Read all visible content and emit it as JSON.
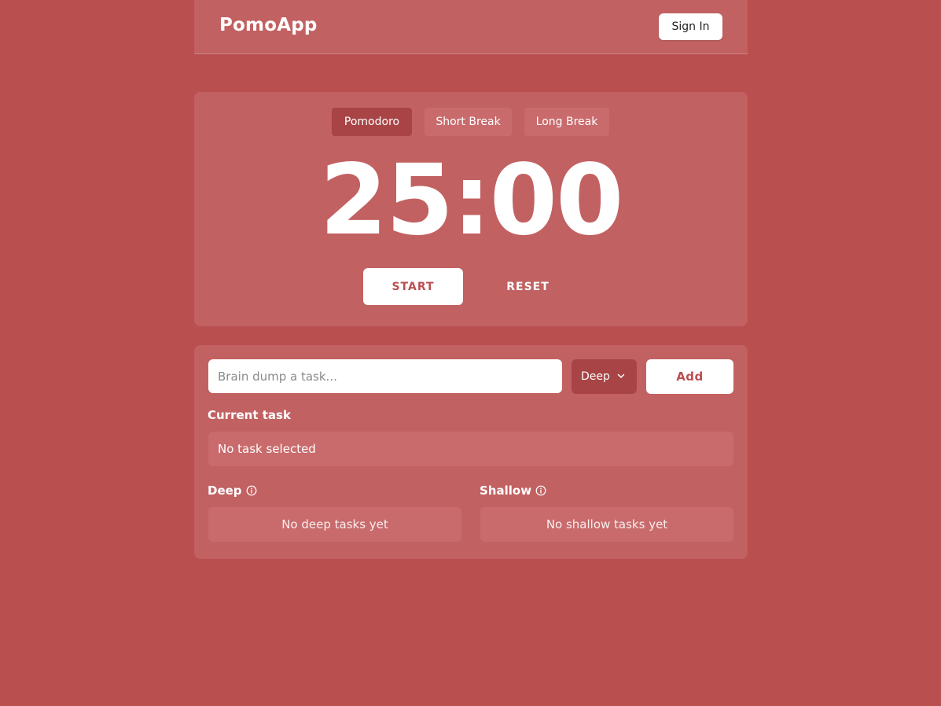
{
  "header": {
    "app_name": "PomoApp",
    "sign_in_label": "Sign In"
  },
  "timer": {
    "modes": [
      {
        "label": "Pomodoro",
        "active": true
      },
      {
        "label": "Short Break",
        "active": false
      },
      {
        "label": "Long Break",
        "active": false
      }
    ],
    "time": "25:00",
    "start_label": "START",
    "reset_label": "RESET"
  },
  "tasks": {
    "input_placeholder": "Brain dump a task...",
    "input_value": "",
    "category_selected": "Deep",
    "add_label": "Add",
    "current_task_heading": "Current task",
    "current_task_value": "No task selected",
    "deep_heading": "Deep",
    "deep_empty": "No deep tasks yet",
    "shallow_heading": "Shallow",
    "shallow_empty": "No shallow tasks yet"
  },
  "colors": {
    "background": "#ba4f50",
    "card": "#c26162",
    "active_tab": "#a84446",
    "accent_text": "#ba4f50"
  },
  "icons": {
    "category_dropdown": "chevron-down-icon",
    "deep_info": "info-icon",
    "shallow_info": "info-icon"
  }
}
